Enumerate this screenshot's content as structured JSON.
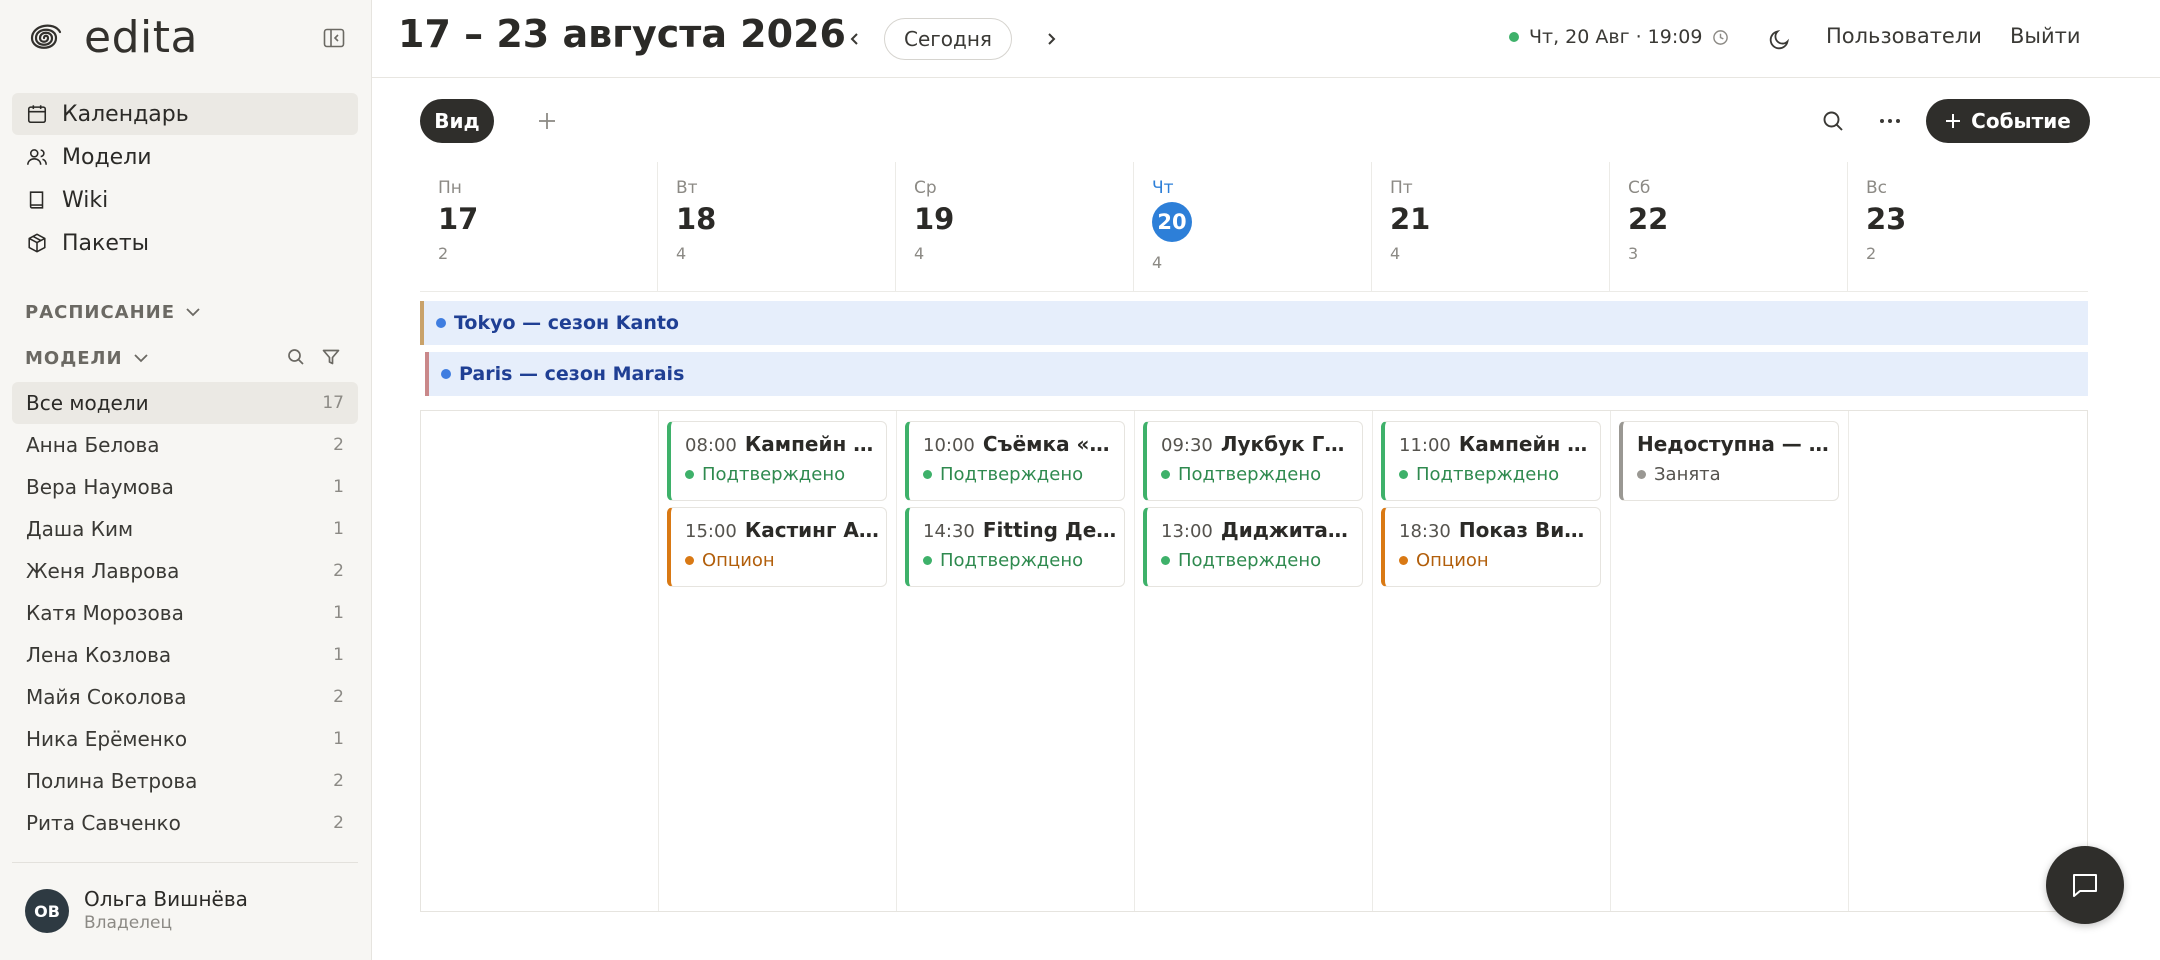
{
  "app": {
    "name": "edita"
  },
  "nav": [
    {
      "label": "Календарь",
      "icon": "calendar-icon",
      "active": true
    },
    {
      "label": "Модели",
      "icon": "users-icon"
    },
    {
      "label": "Wiki",
      "icon": "book-icon"
    },
    {
      "label": "Пакеты",
      "icon": "package-icon"
    }
  ],
  "sections": {
    "schedule": "РАСПИСАНИЕ",
    "models": "МОДЕЛИ"
  },
  "models": [
    {
      "name": "Все модели",
      "count": "17",
      "active": true
    },
    {
      "name": "Анна Белова",
      "count": "2"
    },
    {
      "name": "Вера Наумова",
      "count": "1"
    },
    {
      "name": "Даша Ким",
      "count": "1"
    },
    {
      "name": "Женя Лаврова",
      "count": "2"
    },
    {
      "name": "Катя Морозова",
      "count": "1"
    },
    {
      "name": "Лена Козлова",
      "count": "1"
    },
    {
      "name": "Майя Соколова",
      "count": "2"
    },
    {
      "name": "Ника Ерёменко",
      "count": "1"
    },
    {
      "name": "Полина Ветрова",
      "count": "2"
    },
    {
      "name": "Рита Савченко",
      "count": "2"
    }
  ],
  "user": {
    "initials": "ОВ",
    "name": "Ольга Вишнёва",
    "role": "Владелец"
  },
  "header": {
    "range_title": "17 – 23 августа 2026",
    "today_label": "Сегодня",
    "clock": "Чт, 20 Авг · 19:09",
    "users_link": "Пользователи",
    "logout_link": "Выйти"
  },
  "toolbar": {
    "view_label": "Вид",
    "event_label": "Событие"
  },
  "days": [
    {
      "name": "Пн",
      "num": "17",
      "count": "2"
    },
    {
      "name": "Вт",
      "num": "18",
      "count": "4"
    },
    {
      "name": "Ср",
      "num": "19",
      "count": "4"
    },
    {
      "name": "Чт",
      "num": "20",
      "count": "4",
      "today": true
    },
    {
      "name": "Пт",
      "num": "21",
      "count": "4"
    },
    {
      "name": "Сб",
      "num": "22",
      "count": "3"
    },
    {
      "name": "Вс",
      "num": "23",
      "count": "2"
    }
  ],
  "multi_day_events": [
    {
      "title": "Tokyo — сезон Kanto"
    },
    {
      "title": "Paris — сезон Marais"
    }
  ],
  "events": [
    {
      "day": 1,
      "slot": 0,
      "time": "08:00",
      "title": "Кампейн …",
      "status": "Подтверждено",
      "kind": "confirmed"
    },
    {
      "day": 1,
      "slot": 1,
      "time": "15:00",
      "title": "Кастинг А…",
      "status": "Опцион",
      "kind": "option"
    },
    {
      "day": 2,
      "slot": 0,
      "time": "10:00",
      "title": "Съёмка «Р…",
      "status": "Подтверждено",
      "kind": "confirmed"
    },
    {
      "day": 2,
      "slot": 1,
      "time": "14:30",
      "title": "Fitting Де…",
      "status": "Подтверждено",
      "kind": "confirmed"
    },
    {
      "day": 3,
      "slot": 0,
      "time": "09:30",
      "title": "Лукбук Га…",
      "status": "Подтверждено",
      "kind": "confirmed"
    },
    {
      "day": 3,
      "slot": 1,
      "time": "13:00",
      "title": "Диджитал…",
      "status": "Подтверждено",
      "kind": "confirmed"
    },
    {
      "day": 4,
      "slot": 0,
      "time": "11:00",
      "title": "Кампейн …",
      "status": "Подтверждено",
      "kind": "confirmed"
    },
    {
      "day": 4,
      "slot": 1,
      "time": "18:30",
      "title": "Показ Вит…",
      "status": "Опцион",
      "kind": "option"
    },
    {
      "day": 5,
      "slot": 0,
      "time": "",
      "title": "Недоступна — …",
      "status": "Занята",
      "kind": "busy"
    }
  ],
  "colors": {
    "accent": "#2d7fd8",
    "confirmed": "#3eb16a",
    "option": "#d97914",
    "busy": "#9a9893",
    "dark": "#2f2e2b"
  }
}
